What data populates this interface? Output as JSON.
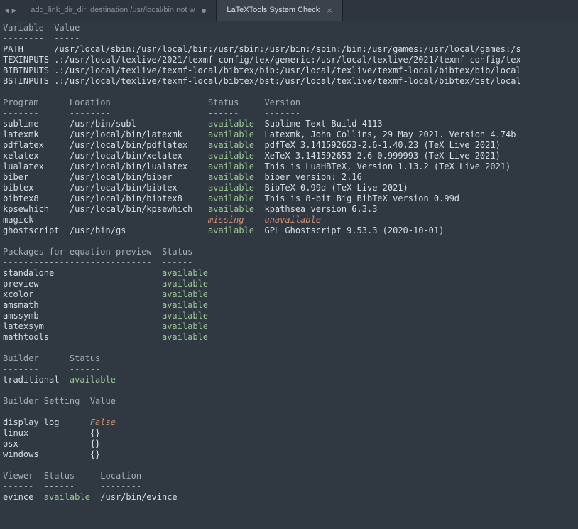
{
  "tabs": {
    "inactive_label": "add_link_dir_dir: destination /usr/local/bin not w",
    "active_label": "LaTeXTools System Check"
  },
  "vars": {
    "header": "Variable  Value",
    "dashes": "--------  -----",
    "rows": [
      {
        "name": "PATH      ",
        "value": "/usr/local/sbin:/usr/local/bin:/usr/sbin:/usr/bin:/sbin:/bin:/usr/games:/usr/local/games:/s"
      },
      {
        "name": "TEXINPUTS ",
        "value": ".:/usr/local/texlive/2021/texmf-config/tex/generic:/usr/local/texlive/2021/texmf-config/tex"
      },
      {
        "name": "BIBINPUTS ",
        "value": ".:/usr/local/texlive/texmf-local/bibtex/bib:/usr/local/texlive/texmf-local/bibtex/bib/local"
      },
      {
        "name": "BSTINPUTS ",
        "value": ".:/usr/local/texlive/texmf-local/bibtex/bst:/usr/local/texlive/texmf-local/bibtex/bst/local"
      }
    ]
  },
  "programs": {
    "header": "Program      Location                   Status     Version",
    "dashes": "-------      --------                   ------     -------",
    "rows": [
      {
        "name": "sublime     ",
        "loc": " /usr/bin/subl              ",
        "status": "available",
        "version": "  Sublime Text Build 4113"
      },
      {
        "name": "latexmk     ",
        "loc": " /usr/local/bin/latexmk     ",
        "status": "available",
        "version": "  Latexmk, John Collins, 29 May 2021. Version 4.74b"
      },
      {
        "name": "pdflatex    ",
        "loc": " /usr/local/bin/pdflatex    ",
        "status": "available",
        "version": "  pdfTeX 3.141592653-2.6-1.40.23 (TeX Live 2021)"
      },
      {
        "name": "xelatex     ",
        "loc": " /usr/local/bin/xelatex     ",
        "status": "available",
        "version": "  XeTeX 3.141592653-2.6-0.999993 (TeX Live 2021)"
      },
      {
        "name": "lualatex    ",
        "loc": " /usr/local/bin/lualatex    ",
        "status": "available",
        "version": "  This is LuaHBTeX, Version 1.13.2 (TeX Live 2021)"
      },
      {
        "name": "biber       ",
        "loc": " /usr/local/bin/biber       ",
        "status": "available",
        "version": "  biber version: 2.16"
      },
      {
        "name": "bibtex      ",
        "loc": " /usr/local/bin/bibtex      ",
        "status": "available",
        "version": "  BibTeX 0.99d (TeX Live 2021)"
      },
      {
        "name": "bibtex8     ",
        "loc": " /usr/local/bin/bibtex8     ",
        "status": "available",
        "version": "  This is 8-bit Big BibTeX version 0.99d"
      },
      {
        "name": "kpsewhich   ",
        "loc": " /usr/local/bin/kpsewhich   ",
        "status": "available",
        "version": "  kpathsea version 6.3.3"
      },
      {
        "name": "magick      ",
        "loc": "                            ",
        "status": "missing",
        "version": "    unavailable",
        "missing": true
      },
      {
        "name": "ghostscript ",
        "loc": " /usr/bin/gs                ",
        "status": "available",
        "version": "  GPL Ghostscript 9.53.3 (2020-10-01)"
      }
    ]
  },
  "packages": {
    "header": "Packages for equation preview  Status",
    "dashes": "-----------------------------  ------",
    "rows": [
      {
        "name": "standalone                     ",
        "status": "available"
      },
      {
        "name": "preview                        ",
        "status": "available"
      },
      {
        "name": "xcolor                         ",
        "status": "available"
      },
      {
        "name": "amsmath                        ",
        "status": "available"
      },
      {
        "name": "amssymb                        ",
        "status": "available"
      },
      {
        "name": "latexsym                       ",
        "status": "available"
      },
      {
        "name": "mathtools                      ",
        "status": "available"
      }
    ]
  },
  "builders": {
    "header": "Builder      Status",
    "dashes": "-------      ------",
    "rows": [
      {
        "name": "traditional  ",
        "status": "available"
      }
    ]
  },
  "builder_settings": {
    "header": "Builder Setting  Value",
    "dashes": "---------------  -----",
    "rows": [
      {
        "name": "display_log      ",
        "value": "False",
        "is_false": true
      },
      {
        "name": "linux            ",
        "value": "{}"
      },
      {
        "name": "osx              ",
        "value": "{}"
      },
      {
        "name": "windows          ",
        "value": "{}"
      }
    ]
  },
  "viewer": {
    "header": "Viewer  Status     Location",
    "dashes": "------  ------     --------",
    "rows": [
      {
        "name": "evince  ",
        "status": "available",
        "loc": "  /usr/bin/evince"
      }
    ]
  }
}
